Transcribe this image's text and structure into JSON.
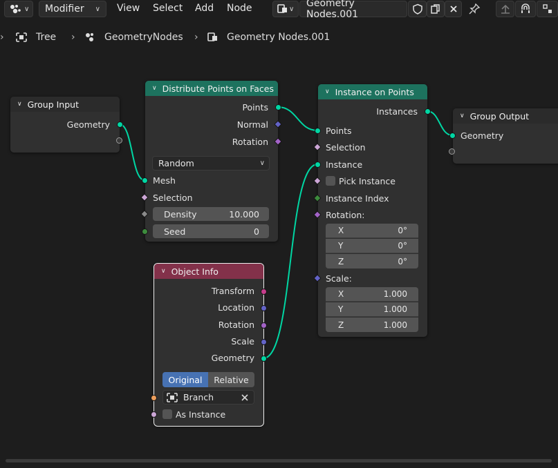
{
  "header": {
    "editor_type_icon": "geometry-nodes-icon",
    "mode_label": "Modifier",
    "menus": [
      "View",
      "Select",
      "Add",
      "Node"
    ],
    "node_tree_name": "Geometry Nodes.001"
  },
  "breadcrumb": {
    "object": "Tree",
    "modifier": "GeometryNodes",
    "node_group": "Geometry Nodes.001"
  },
  "colors": {
    "geometry_socket": "#00d6a3",
    "vector_socket": "#6363c7",
    "rotation_socket": "#a363c7",
    "matrix_socket": "#c73d8c",
    "integer_socket": "#3d8c3d",
    "object_socket": "#ed9e5c",
    "boolean_socket": "#cca6d6",
    "geometry_header": "#1d725e",
    "input_header": "#83314a",
    "wire": "#00d6a3",
    "active_button": "#4772b3"
  },
  "nodes": {
    "group_input": {
      "title": "Group Input",
      "outputs": [
        "Geometry"
      ]
    },
    "distribute": {
      "title": "Distribute Points on Faces",
      "outputs": [
        "Points",
        "Normal",
        "Rotation"
      ],
      "mode": "Random",
      "inputs": [
        "Mesh",
        "Selection"
      ],
      "density_label": "Density",
      "density_value": "10.000",
      "seed_label": "Seed",
      "seed_value": "0"
    },
    "instance_on_points": {
      "title": "Instance on Points",
      "output": "Instances",
      "inputs": [
        "Points",
        "Selection",
        "Instance",
        "Pick Instance",
        "Instance Index",
        "Rotation:",
        "Scale:"
      ],
      "rotation": [
        {
          "axis": "X",
          "value": "0°"
        },
        {
          "axis": "Y",
          "value": "0°"
        },
        {
          "axis": "Z",
          "value": "0°"
        }
      ],
      "scale": [
        {
          "axis": "X",
          "value": "1.000"
        },
        {
          "axis": "Y",
          "value": "1.000"
        },
        {
          "axis": "Z",
          "value": "1.000"
        }
      ]
    },
    "group_output": {
      "title": "Group Output",
      "inputs": [
        "Geometry"
      ]
    },
    "object_info": {
      "title": "Object Info",
      "outputs": [
        "Transform",
        "Location",
        "Rotation",
        "Scale",
        "Geometry"
      ],
      "transform_space": [
        "Original",
        "Relative"
      ],
      "object": "Branch",
      "as_instance": "As Instance"
    }
  }
}
